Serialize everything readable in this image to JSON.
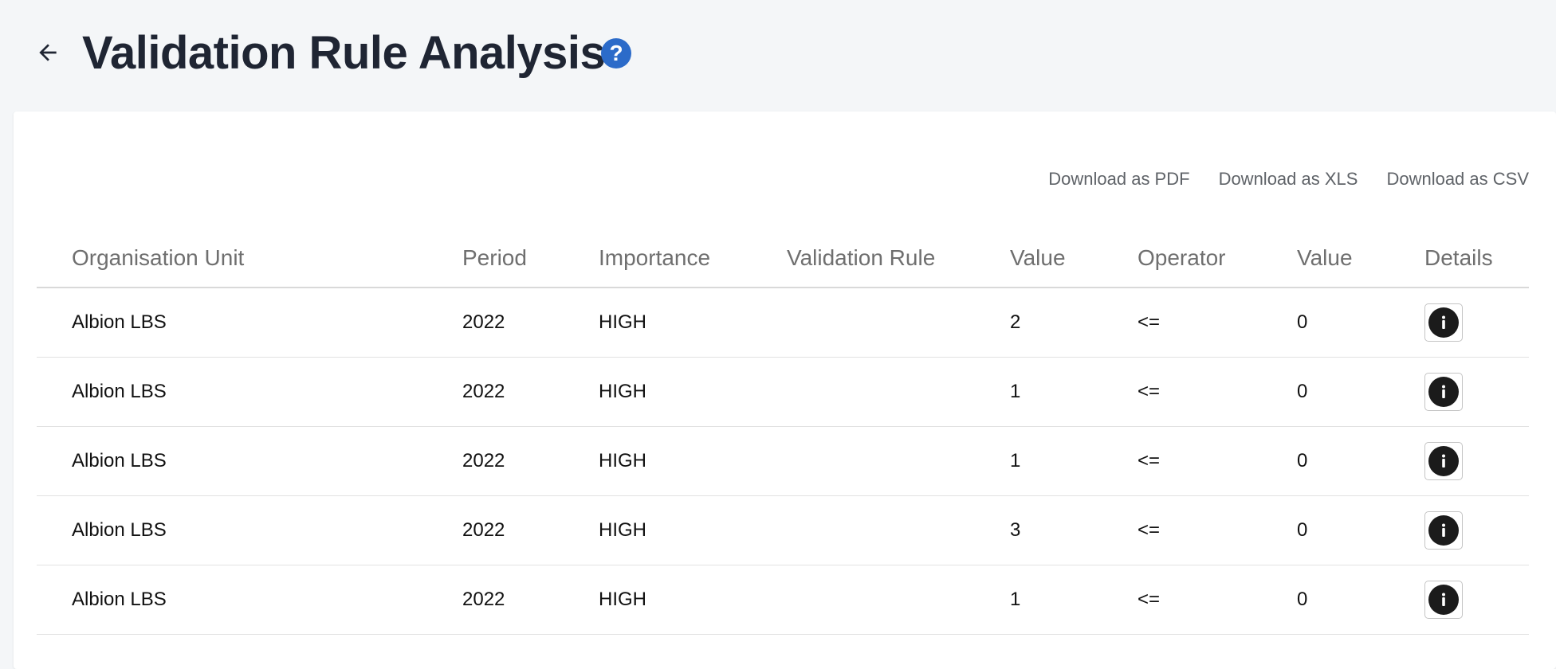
{
  "header": {
    "back_icon": "arrow-left-icon",
    "title": "Validation Rule Analysis",
    "help_icon": "help-circle-icon",
    "help_glyph": "?",
    "help_color": "#2c6bc9"
  },
  "downloads": {
    "pdf_label": "Download as PDF",
    "xls_label": "Download as XLS",
    "csv_label": "Download as CSV"
  },
  "table": {
    "columns": [
      "Organisation Unit",
      "Period",
      "Importance",
      "Validation Rule",
      "Value",
      "Operator",
      "Value",
      "Details"
    ],
    "rows": [
      {
        "org_unit": "Albion LBS",
        "period": "2022",
        "importance": "HIGH",
        "rule": "",
        "left_value": "2",
        "operator": "<=",
        "right_value": "0",
        "details_icon": "info-icon"
      },
      {
        "org_unit": "Albion LBS",
        "period": "2022",
        "importance": "HIGH",
        "rule": "",
        "left_value": "1",
        "operator": "<=",
        "right_value": "0",
        "details_icon": "info-icon"
      },
      {
        "org_unit": "Albion LBS",
        "period": "2022",
        "importance": "HIGH",
        "rule": "",
        "left_value": "1",
        "operator": "<=",
        "right_value": "0",
        "details_icon": "info-icon"
      },
      {
        "org_unit": "Albion LBS",
        "period": "2022",
        "importance": "HIGH",
        "rule": "",
        "left_value": "3",
        "operator": "<=",
        "right_value": "0",
        "details_icon": "info-icon"
      },
      {
        "org_unit": "Albion LBS",
        "period": "2022",
        "importance": "HIGH",
        "rule": "",
        "left_value": "1",
        "operator": "<=",
        "right_value": "0",
        "details_icon": "info-icon"
      }
    ]
  }
}
